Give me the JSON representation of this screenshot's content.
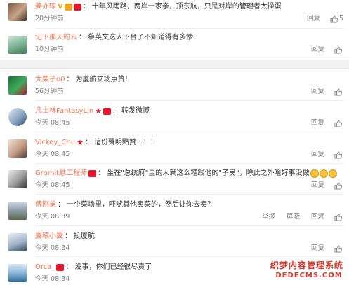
{
  "actions": {
    "reply": "回复",
    "report": "举报",
    "block": "屏蔽"
  },
  "top_comments": [
    {
      "name": "姜亦琛",
      "sep": "：",
      "text": "十年风雨路，两岸一家亲，顶东航，只是对岸的管理者太操蛋",
      "time": "20分钟前",
      "likes": "5"
    },
    {
      "name": "记下那天的云",
      "sep": "：",
      "text": "蔡英文这人下台了不知道得有多惨",
      "time": "10分钟前",
      "likes": ""
    }
  ],
  "comments": [
    {
      "name": "大栗子o0",
      "sep": "：",
      "text": "为厦航立场点赞！",
      "time": "56分钟前",
      "likes": ""
    },
    {
      "name": "凡士林FantasyLin",
      "sep": "：",
      "text": "转发微博",
      "time": "今天 08:45",
      "likes": ""
    },
    {
      "name": "Vickey_Chu",
      "sep": "：",
      "text": "這份聲明點贊！！！",
      "time": "今天 08:45",
      "likes": ""
    },
    {
      "name": "Gromit悬工程师",
      "sep": "：",
      "text": "坐在\"总统府\"里的人就这么糟践他的\"子民\"，除此之外啥好事没做",
      "time": "今天 08:45",
      "likes": ""
    },
    {
      "name": "傅刚弟",
      "sep": "：",
      "text": "一个菜场里，吓唬其他卖菜的，然后让你去卖？",
      "time": "今天 08:39",
      "likes": ""
    },
    {
      "name": "翼稿小翼",
      "sep": "：",
      "text": "挺厦航",
      "time": "今天 08:34",
      "likes": ""
    },
    {
      "name": "Orca_",
      "sep": "：",
      "text": "没事，你们已经很尽责了",
      "time": "今天 08:34",
      "likes": ""
    }
  ],
  "watermark": {
    "line1": "织梦内容管理系统",
    "line2": "DEDECMS.COM"
  },
  "colors": {
    "name": "#eb7350",
    "meta": "#808080",
    "text": "#333333",
    "gap": "#f2f2f2",
    "badge_red": "#e6162d"
  }
}
